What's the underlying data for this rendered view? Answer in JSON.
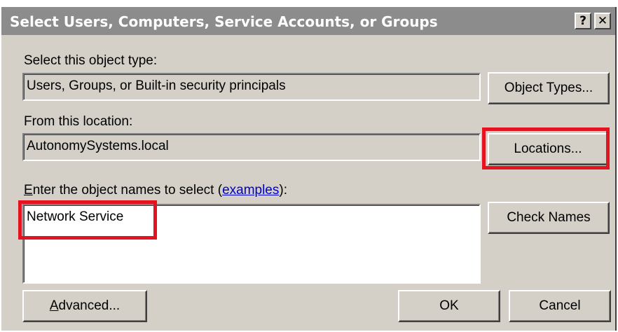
{
  "dialog": {
    "title": "Select Users, Computers, Service Accounts, or Groups",
    "help_button": "?",
    "close_button": "✕"
  },
  "object_type": {
    "label": "Select this object type:",
    "value": "Users, Groups, or Built-in security principals",
    "button": "Object Types..."
  },
  "location": {
    "label": "From this location:",
    "value": "AutonomySystems.local",
    "button": "Locations..."
  },
  "names": {
    "label_prefix": "nter the object names to select (",
    "label_access_key": "E",
    "label_link": "examples",
    "label_suffix": "):",
    "value": "Network Service",
    "check_button": "Check Names"
  },
  "footer": {
    "advanced_button_prefix": "dvanced...",
    "advanced_access_key": "A",
    "ok_button": "OK",
    "cancel_button": "Cancel"
  },
  "highlight_color": "#e3141f"
}
